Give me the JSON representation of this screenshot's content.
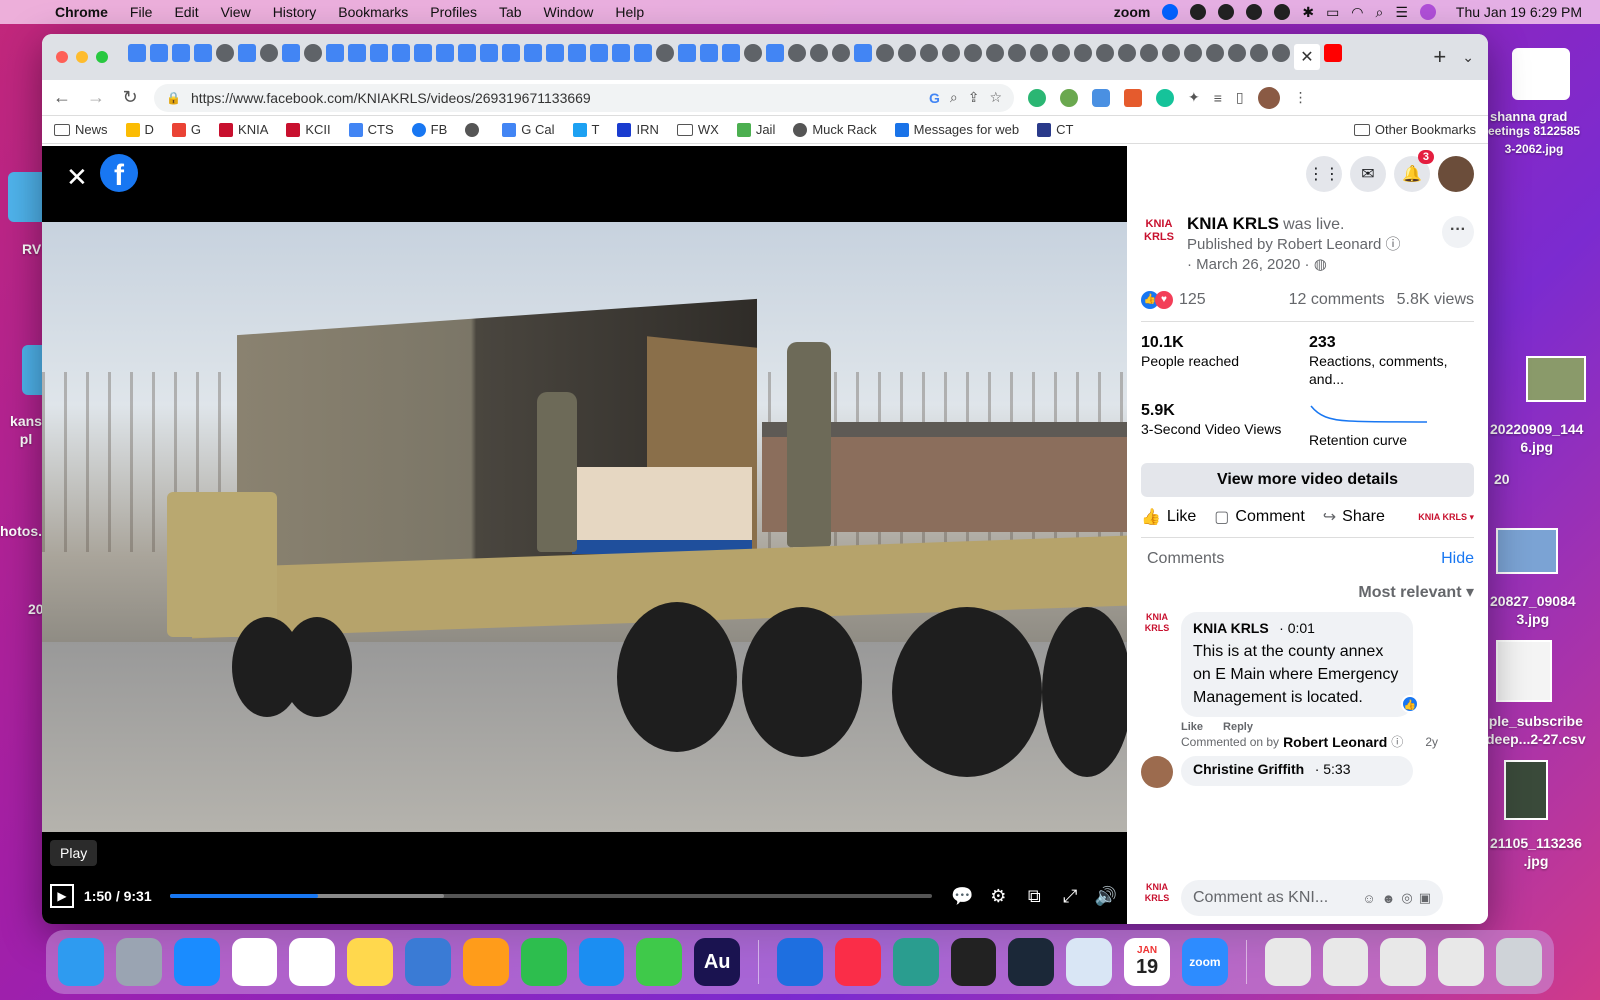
{
  "menubar": {
    "apple_icon": "apple-icon",
    "app_name": "Chrome",
    "menus": [
      "File",
      "Edit",
      "View",
      "History",
      "Bookmarks",
      "Profiles",
      "Tab",
      "Window",
      "Help"
    ],
    "zoom_label": "zoom",
    "clock": "Thu Jan 19  6:29 PM"
  },
  "desktop": {
    "labels": [
      "RV",
      "kans pl",
      "hotos.",
      "20",
      "20220909_144\n6.jpg",
      "20827_09084\n3.jpg",
      "ple_subscribe\ndeep...2-27.csv",
      "21105_113236\n.jpg",
      "shanna grad",
      "eetings 8122585\n3-2062.jpg",
      "20"
    ]
  },
  "browser": {
    "url": "https://www.facebook.com/KNIAKRLS/videos/269319671133669",
    "bookmarks": [
      {
        "label": "News",
        "icon": "folder-icon"
      },
      {
        "label": "D",
        "icon": "google-drive-icon"
      },
      {
        "label": "G",
        "icon": "gmail-icon"
      },
      {
        "label": "KNIA",
        "icon": "knia-icon"
      },
      {
        "label": "KCII",
        "icon": "kcii-icon"
      },
      {
        "label": "CTS",
        "icon": "google-icon"
      },
      {
        "label": "FB",
        "icon": "facebook-icon"
      },
      {
        "label": "",
        "icon": "globe-icon"
      },
      {
        "label": "G Cal",
        "icon": "calendar-icon"
      },
      {
        "label": "T",
        "icon": "twitter-icon"
      },
      {
        "label": "IRN",
        "icon": "irn-icon"
      },
      {
        "label": "WX",
        "icon": "folder-icon"
      },
      {
        "label": "Jail",
        "icon": "jail-icon"
      },
      {
        "label": "Muck Rack",
        "icon": "globe-icon"
      },
      {
        "label": "Messages for web",
        "icon": "messages-icon"
      },
      {
        "label": "CT",
        "icon": "ct-icon"
      }
    ],
    "other_bookmarks": "Other Bookmarks"
  },
  "video": {
    "tooltip": "Play",
    "time": "1:50 / 9:31",
    "progress_played": 0.195,
    "progress_buffered": 0.36
  },
  "post": {
    "page_name": "KNIA KRLS",
    "was_live": "was live.",
    "published_by": "Published by Robert Leonard",
    "date": "· March 26, 2020 ·",
    "reactions": "125",
    "comments_count": "12 comments",
    "views": "5.8K views",
    "insights": {
      "reached_num": "10.1K",
      "reached_lbl": "People reached",
      "reactions_num": "233",
      "reactions_lbl": "Reactions, comments, and...",
      "video_views_num": "5.9K",
      "video_views_lbl": "3-Second Video Views",
      "retention_lbl": "Retention curve"
    },
    "details_button": "View more video details",
    "actions": {
      "like": "Like",
      "comment": "Comment",
      "share": "Share"
    },
    "page_avatar_text": "KNIA KRLS"
  },
  "comments": {
    "tab": "Comments",
    "hide": "Hide",
    "sort": "Most relevant",
    "items": [
      {
        "name": "KNIA KRLS",
        "time": "· 0:01",
        "text": "This is at the county annex on E Main where Emergency Management is located.",
        "like": "Like",
        "reply": "Reply",
        "commented_on_by": "Commented on by",
        "by_name": "Robert Leonard",
        "age": "2y"
      },
      {
        "name": "Christine Griffith",
        "time": "· 5:33"
      }
    ],
    "input_placeholder": "Comment as KNI..."
  },
  "notifications_badge": "3",
  "dock": {
    "apps": [
      "finder",
      "launchpad",
      "safari",
      "chrome",
      "photos",
      "notes",
      "keynote",
      "pages",
      "numbers",
      "app-store",
      "messages",
      "Au",
      "bluetooth",
      "music",
      "zoom-app",
      "piano",
      "steam",
      "preview",
      "calendar",
      "zoom"
    ],
    "calendar_month": "JAN",
    "calendar_day": "19",
    "zoom_label": "zoom"
  }
}
